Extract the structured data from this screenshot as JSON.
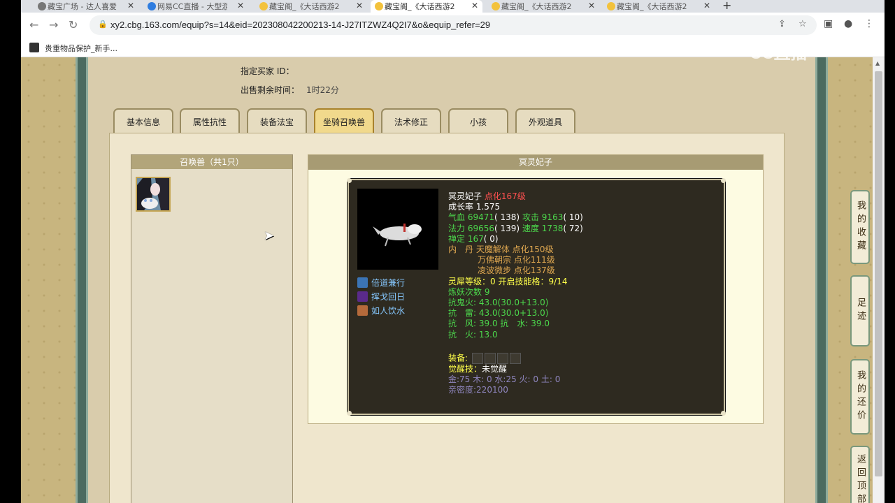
{
  "browser": {
    "tabs": [
      {
        "title": "藏宝广场 - 达人喜爱...",
        "icon_color": "#777"
      },
      {
        "title": "网易CC直播 - 大型游戏...",
        "icon_color": "#2f7de0"
      },
      {
        "title": "藏宝阁_《大话西游2》...",
        "icon_color": "#f3c23c"
      },
      {
        "title": "藏宝阁_《大话西游2》...",
        "icon_color": "#f3c23c"
      },
      {
        "title": "藏宝阁_《大话西游2》...",
        "icon_color": "#f3c23c"
      },
      {
        "title": "藏宝阁_《大话西游2》...",
        "icon_color": "#f3c23c"
      }
    ],
    "active_tab_index": 3,
    "url": "xy2.cbg.163.com/equip?s=14&eid=202308042200213-14-J27ITZWZ4Q2I7&o&equip_refer=29",
    "bookmark_label": "贵重物品保护_新手..."
  },
  "page": {
    "designated_buyer_label": "指定买家 ID：",
    "designated_buyer_value": "",
    "remaining_time_label": "出售剩余时间：",
    "remaining_time_value": "1时22分",
    "tabs": [
      "基本信息",
      "属性抗性",
      "装备法宝",
      "坐骑召唤兽",
      "法术修正",
      "小孩",
      "外观道具"
    ],
    "active_tab": "坐骑召唤兽",
    "summon_list_title": "召唤兽（共1只）",
    "detail_title": "冥灵妃子",
    "pet": {
      "name": "冥灵妃子",
      "level": "点化167级",
      "growth_line": "成长率 1.575",
      "hp_label": "气血",
      "hp_value": "69471",
      "hp_points": "( 138)",
      "atk_label": "攻击",
      "atk_value": "9163",
      "atk_points": "( 10)",
      "mp_label": "法力",
      "mp_value": "69656",
      "mp_points": "( 139)",
      "spd_label": "速度",
      "spd_value": "1738",
      "spd_points": "( 72)",
      "zen_label": "禅定",
      "zen_value": "167",
      "zen_points": "( 0)",
      "inner_dan_label": "内　丹",
      "inner_dan": [
        "天魔解体 点化150级",
        "万佛朝宗 点化111级",
        "凌波微步 点化137级"
      ],
      "lingxi_label": "灵犀等级：",
      "lingxi_value": "0",
      "lingxi_skill_label": "开启技能格：",
      "lingxi_skill_value": "9/14",
      "refine_label": "炼妖次数",
      "refine_value": "9",
      "resist_ghost_fire_label": "抗鬼火:",
      "resist_ghost_fire_value": "43.0",
      "resist_ghost_fire_detail": "(30.0+13.0)",
      "resist_thunder_label": "抗　雷:",
      "resist_thunder_value": "43.0",
      "resist_thunder_detail": "(30.0+13.0)",
      "resist_wind_label": "抗　风:",
      "resist_wind_value": "39.0",
      "resist_water_label": "抗　水:",
      "resist_water_value": "39.0",
      "resist_fire_label": "抗　火:",
      "resist_fire_value": "13.0",
      "equip_label": "装备:",
      "awaken_label": "觉醒技：",
      "awaken_value": "未觉醒",
      "elements": "金:75 木: 0 水:25 火: 0 土: 0",
      "intimacy": "亲密度:220100",
      "skills": [
        "倍道兼行",
        "挥戈回日",
        "如人饮水"
      ]
    },
    "right_nav": [
      "我的收藏",
      "足迹",
      "我的还价",
      "返回顶部"
    ]
  },
  "overlay": {
    "watermark": "CC直播"
  },
  "colors": {
    "gold_tab_active": "#f1d98c",
    "tooltip_bg": "#2e2a20",
    "green_stat": "#4cd84c",
    "red_level": "#ff5050",
    "skill_blue": "#86c8ff"
  }
}
